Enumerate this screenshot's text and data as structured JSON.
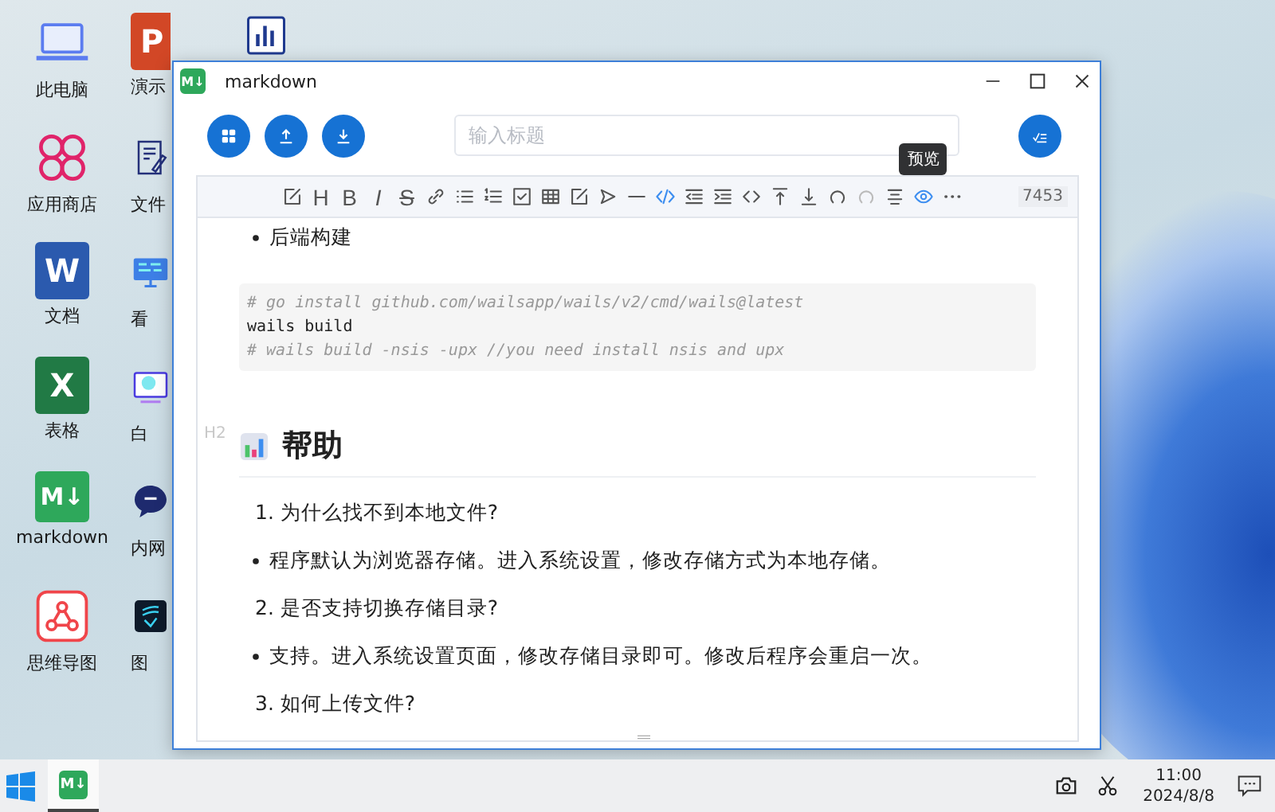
{
  "desktop_columns": [
    {
      "icons": [
        {
          "kind": "laptop",
          "label": "此电脑"
        },
        {
          "kind": "store",
          "label": "应用商店"
        },
        {
          "kind": "word",
          "label": "文档",
          "glyph": "W"
        },
        {
          "kind": "excel",
          "label": "表格",
          "glyph": "X"
        },
        {
          "kind": "markdown",
          "label": "markdown",
          "glyph": "M↓"
        },
        {
          "kind": "mindmap",
          "label": "思维导图"
        }
      ]
    },
    {
      "icons": [
        {
          "kind": "ppt",
          "label": "演示",
          "glyph": "P"
        },
        {
          "kind": "editor",
          "label": "文件"
        },
        {
          "kind": "board",
          "label": "看"
        },
        {
          "kind": "whiteboard",
          "label": "白"
        },
        {
          "kind": "chat",
          "label": "内网"
        },
        {
          "kind": "image",
          "label": "图"
        }
      ]
    },
    {
      "icons": [
        {
          "kind": "chart"
        }
      ]
    }
  ],
  "window": {
    "title": "markdown",
    "app_glyph": "M↓"
  },
  "actions": [
    {
      "kind": "grid"
    },
    {
      "kind": "upload"
    },
    {
      "kind": "download"
    }
  ],
  "title_input": {
    "placeholder": "输入标题"
  },
  "publish_button": {
    "kind": "publish"
  },
  "editor": {
    "tools": [
      {
        "kind": "edit",
        "active": false,
        "disabled": false
      },
      {
        "kind": "letter",
        "glyph": "H",
        "active": false,
        "disabled": false
      },
      {
        "kind": "letter",
        "glyph": "B",
        "active": false,
        "disabled": false
      },
      {
        "kind": "letter",
        "glyph": "I",
        "active": false,
        "disabled": false
      },
      {
        "kind": "letter",
        "glyph": "S",
        "active": false,
        "disabled": false
      },
      {
        "kind": "link",
        "active": false,
        "disabled": false
      },
      {
        "kind": "ul",
        "active": false,
        "disabled": false
      },
      {
        "kind": "ol",
        "active": false,
        "disabled": false
      },
      {
        "kind": "task",
        "active": false,
        "disabled": false
      },
      {
        "kind": "table",
        "active": false,
        "disabled": false
      },
      {
        "kind": "edit",
        "active": false,
        "disabled": false
      },
      {
        "kind": "send",
        "active": false,
        "disabled": false
      },
      {
        "kind": "hr",
        "active": false,
        "disabled": false
      },
      {
        "kind": "code",
        "active": true,
        "disabled": false
      },
      {
        "kind": "outdent",
        "active": false,
        "disabled": false
      },
      {
        "kind": "indent",
        "active": false,
        "disabled": false
      },
      {
        "kind": "inline",
        "active": false,
        "disabled": false
      },
      {
        "kind": "top",
        "active": false,
        "disabled": false
      },
      {
        "kind": "bottom",
        "active": false,
        "disabled": false
      },
      {
        "kind": "undo",
        "active": false,
        "disabled": false
      },
      {
        "kind": "redo",
        "active": false,
        "disabled": true
      },
      {
        "kind": "align",
        "active": false,
        "disabled": false
      },
      {
        "kind": "eye",
        "active": true,
        "disabled": false,
        "tooltip": "预览"
      },
      {
        "kind": "more",
        "active": false,
        "disabled": false
      }
    ],
    "count": "7453",
    "blocks": [
      {
        "kind": "bullet",
        "text": "后端构建"
      },
      {
        "kind": "code",
        "lines": [
          {
            "text": "# go install github.com/wailsapp/wails/v2/cmd/wails@latest",
            "comment": true
          },
          {
            "text": "wails build",
            "comment": false
          },
          {
            "text": "# wails build -nsis -upx //you need install nsis and upx",
            "comment": true
          }
        ]
      },
      {
        "kind": "heading",
        "level": "H2",
        "text": "帮助"
      },
      {
        "kind": "ordered",
        "text": "1. 为什么找不到本地文件?"
      },
      {
        "kind": "bullet",
        "text": "程序默认为浏览器存储。进入系统设置，修改存储方式为本地存储。"
      },
      {
        "kind": "ordered",
        "text": "2. 是否支持切换存储目录?"
      },
      {
        "kind": "bullet",
        "text": "支持。进入系统设置页面，修改存储目录即可。修改后程序会重启一次。"
      },
      {
        "kind": "ordered",
        "text": "3. 如何上传文件?"
      }
    ]
  },
  "taskbar": {
    "app_glyph": "M↓",
    "app_active": true,
    "time": "11:00",
    "date": "2024/8/8"
  }
}
